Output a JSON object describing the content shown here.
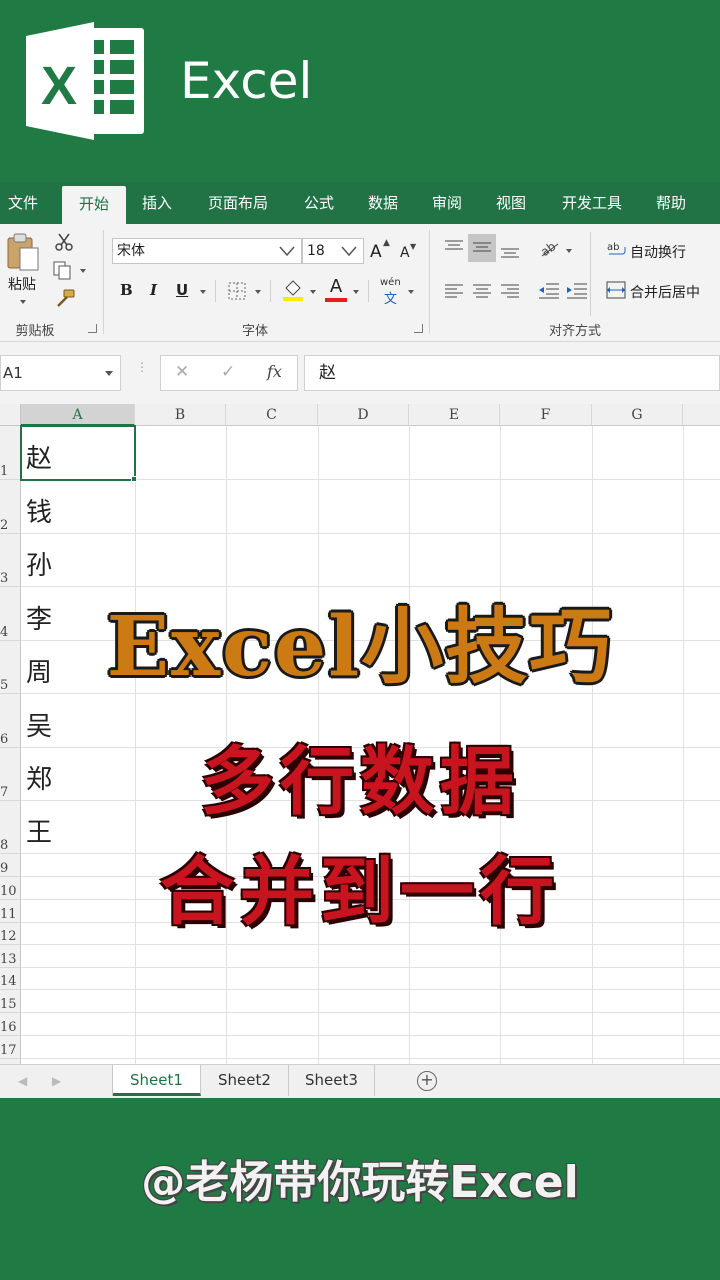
{
  "app": {
    "title": "Excel"
  },
  "ribbon": {
    "tabs": [
      {
        "label": "文件"
      },
      {
        "label": "开始",
        "active": true
      },
      {
        "label": "插入"
      },
      {
        "label": "页面布局"
      },
      {
        "label": "公式"
      },
      {
        "label": "数据"
      },
      {
        "label": "审阅"
      },
      {
        "label": "视图"
      },
      {
        "label": "开发工具"
      },
      {
        "label": "帮助"
      }
    ],
    "clipboard": {
      "paste_label": "粘贴",
      "group_label": "剪贴板"
    },
    "font": {
      "name": "宋体",
      "size": "18",
      "grow": "A",
      "shrink": "A",
      "bold": "B",
      "italic": "I",
      "underline": "U",
      "font_color_glyph": "A",
      "phonetic_glyph": "wén",
      "group_label": "字体"
    },
    "alignment": {
      "wrap_text": "自动换行",
      "merge_center": "合并后居中",
      "group_label": "对齐方式"
    }
  },
  "formula_bar": {
    "name_box": "A1",
    "cancel_glyph": "✕",
    "enter_glyph": "✓",
    "fx_glyph": "fx",
    "content": "赵"
  },
  "sheet": {
    "columns": [
      "A",
      "B",
      "C",
      "D",
      "E",
      "F",
      "G"
    ],
    "row_numbers": [
      "1",
      "2",
      "3",
      "4",
      "5",
      "6",
      "7",
      "8",
      "9",
      "10",
      "11",
      "12",
      "13",
      "14",
      "15",
      "16",
      "17"
    ],
    "cells_a": [
      "赵",
      "钱",
      "孙",
      "李",
      "周",
      "吴",
      "郑",
      "王"
    ],
    "selected_cell": "A1",
    "tabs": [
      "Sheet1",
      "Sheet2",
      "Sheet3"
    ],
    "active_tab": "Sheet1",
    "add_glyph": "+"
  },
  "overlay": {
    "headline": "Excel小技巧",
    "line1": "多行数据",
    "line2": "合并到一行"
  },
  "footer": {
    "watermark": "@老杨带你玩转Excel"
  },
  "colors": {
    "brand_green": "#217346",
    "banner_green": "#1f7a44",
    "headline_orange": "#cc7a14",
    "subtitle_red": "#c8141e"
  }
}
